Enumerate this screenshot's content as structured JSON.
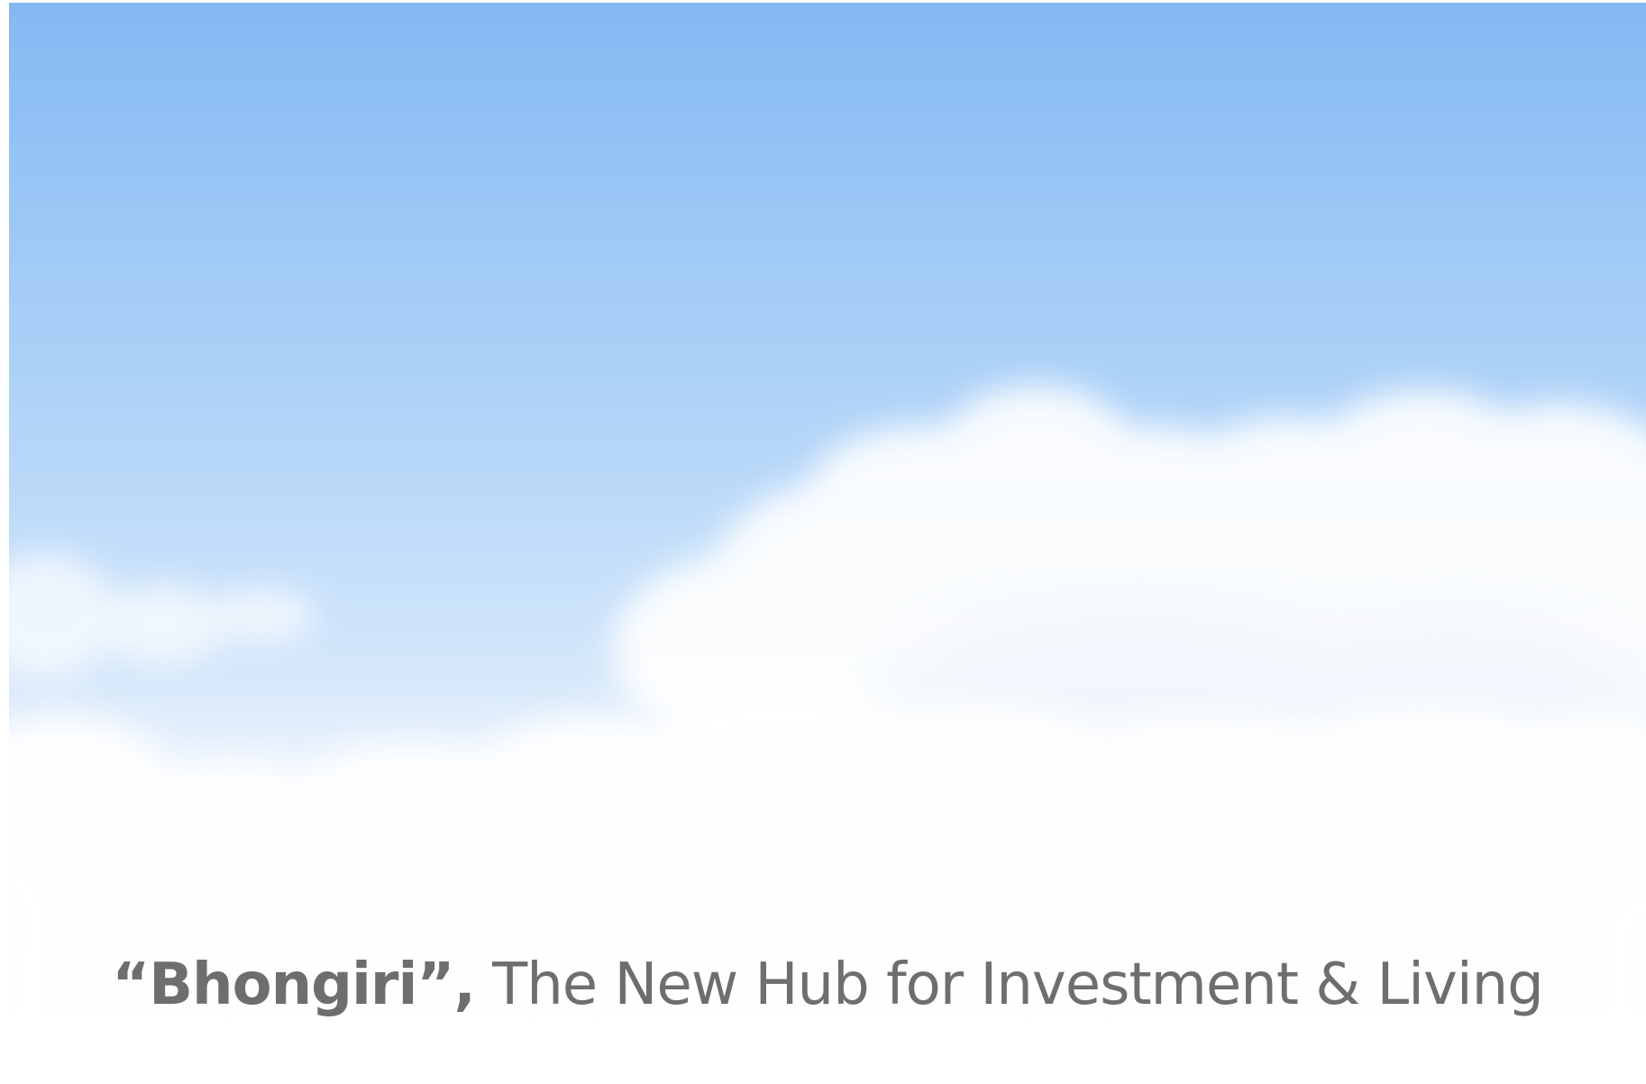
{
  "slide": {
    "background_colors": {
      "sky_top": "#84b8f2",
      "sky_bottom": "#ffffff",
      "cloud": "#ffffff",
      "text": "#6e6e6e"
    },
    "caption": {
      "bold_part": "“Bhongiri”,",
      "regular_part": " The New Hub for Investment & Living"
    }
  }
}
